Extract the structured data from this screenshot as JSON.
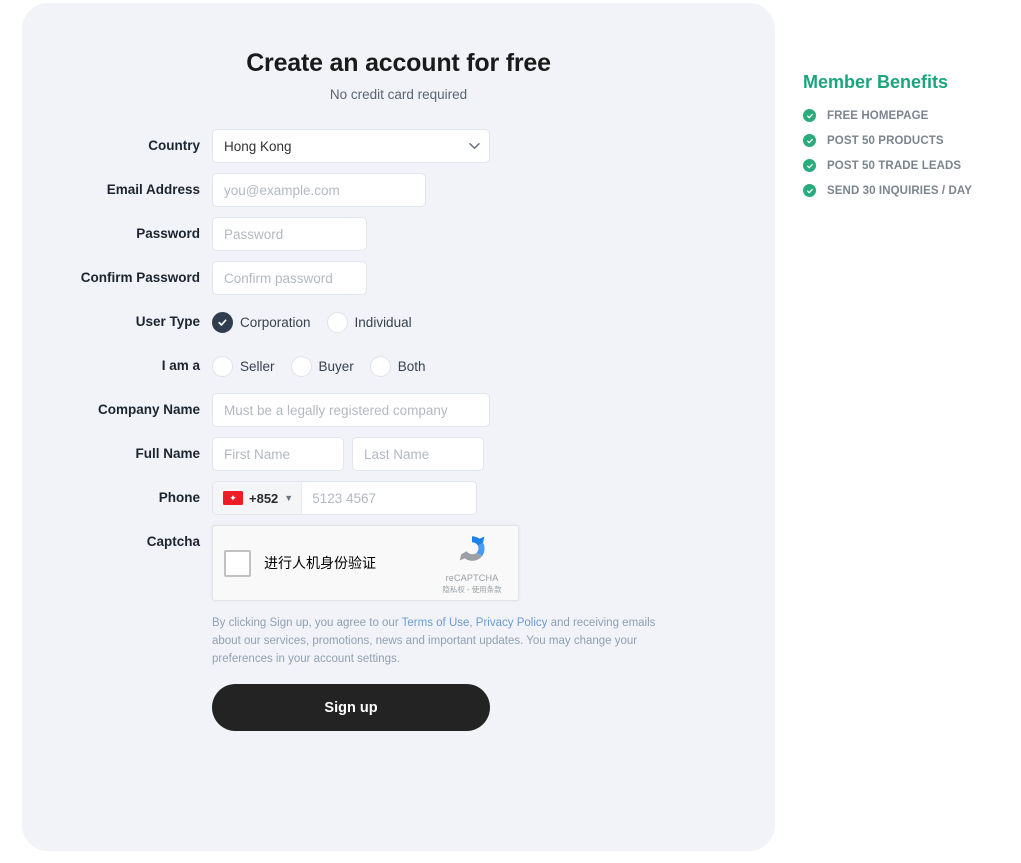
{
  "form": {
    "title": "Create an account for free",
    "subtitle": "No credit card required",
    "fields": {
      "country": {
        "label": "Country",
        "value": "Hong Kong",
        "icon": "chevron-down-icon"
      },
      "email": {
        "label": "Email Address",
        "placeholder": "you@example.com",
        "value": ""
      },
      "password": {
        "label": "Password",
        "placeholder": "Password",
        "value": ""
      },
      "confirm_password": {
        "label": "Confirm Password",
        "placeholder": "Confirm password",
        "value": ""
      },
      "user_type": {
        "label": "User Type",
        "options": [
          {
            "label": "Corporation",
            "selected": true
          },
          {
            "label": "Individual",
            "selected": false
          }
        ]
      },
      "i_am_a": {
        "label": "I am a",
        "options": [
          {
            "label": "Seller",
            "selected": false
          },
          {
            "label": "Buyer",
            "selected": false
          },
          {
            "label": "Both",
            "selected": false
          }
        ]
      },
      "company_name": {
        "label": "Company Name",
        "placeholder": "Must be a legally registered company",
        "value": ""
      },
      "full_name": {
        "label": "Full Name",
        "first_placeholder": "First Name",
        "last_placeholder": "Last Name",
        "first_value": "",
        "last_value": ""
      },
      "phone": {
        "label": "Phone",
        "country_code": "+852",
        "flag": "hong-kong-flag-icon",
        "placeholder": "5123 4567",
        "value": ""
      },
      "captcha": {
        "label": "Captcha",
        "checkbox_text": "进行人机身份验证",
        "brand": "reCAPTCHA",
        "links": "隐私权 - 使用条款"
      }
    },
    "terms": {
      "part1": "By clicking Sign up, you agree to our ",
      "link1": "Terms of Use",
      "part2": ", ",
      "link2": "Privacy Policy",
      "part3": " and receiving emails about our services, promotions, news and important updates. You may change your preferences in your account settings."
    },
    "submit_label": "Sign up"
  },
  "benefits": {
    "title": "Member Benefits",
    "items": [
      {
        "label": "FREE HOMEPAGE"
      },
      {
        "label": "POST 50 PRODUCTS"
      },
      {
        "label": "POST 50 TRADE LEADS"
      },
      {
        "label": "SEND 30 INQUIRIES / DAY"
      }
    ]
  },
  "colors": {
    "card_bg": "#f1f3f8",
    "accent_green": "#1ba47e",
    "button_dark": "#232323",
    "link_blue": "#6b9bd8",
    "selected_radio": "#2f3d4f"
  }
}
